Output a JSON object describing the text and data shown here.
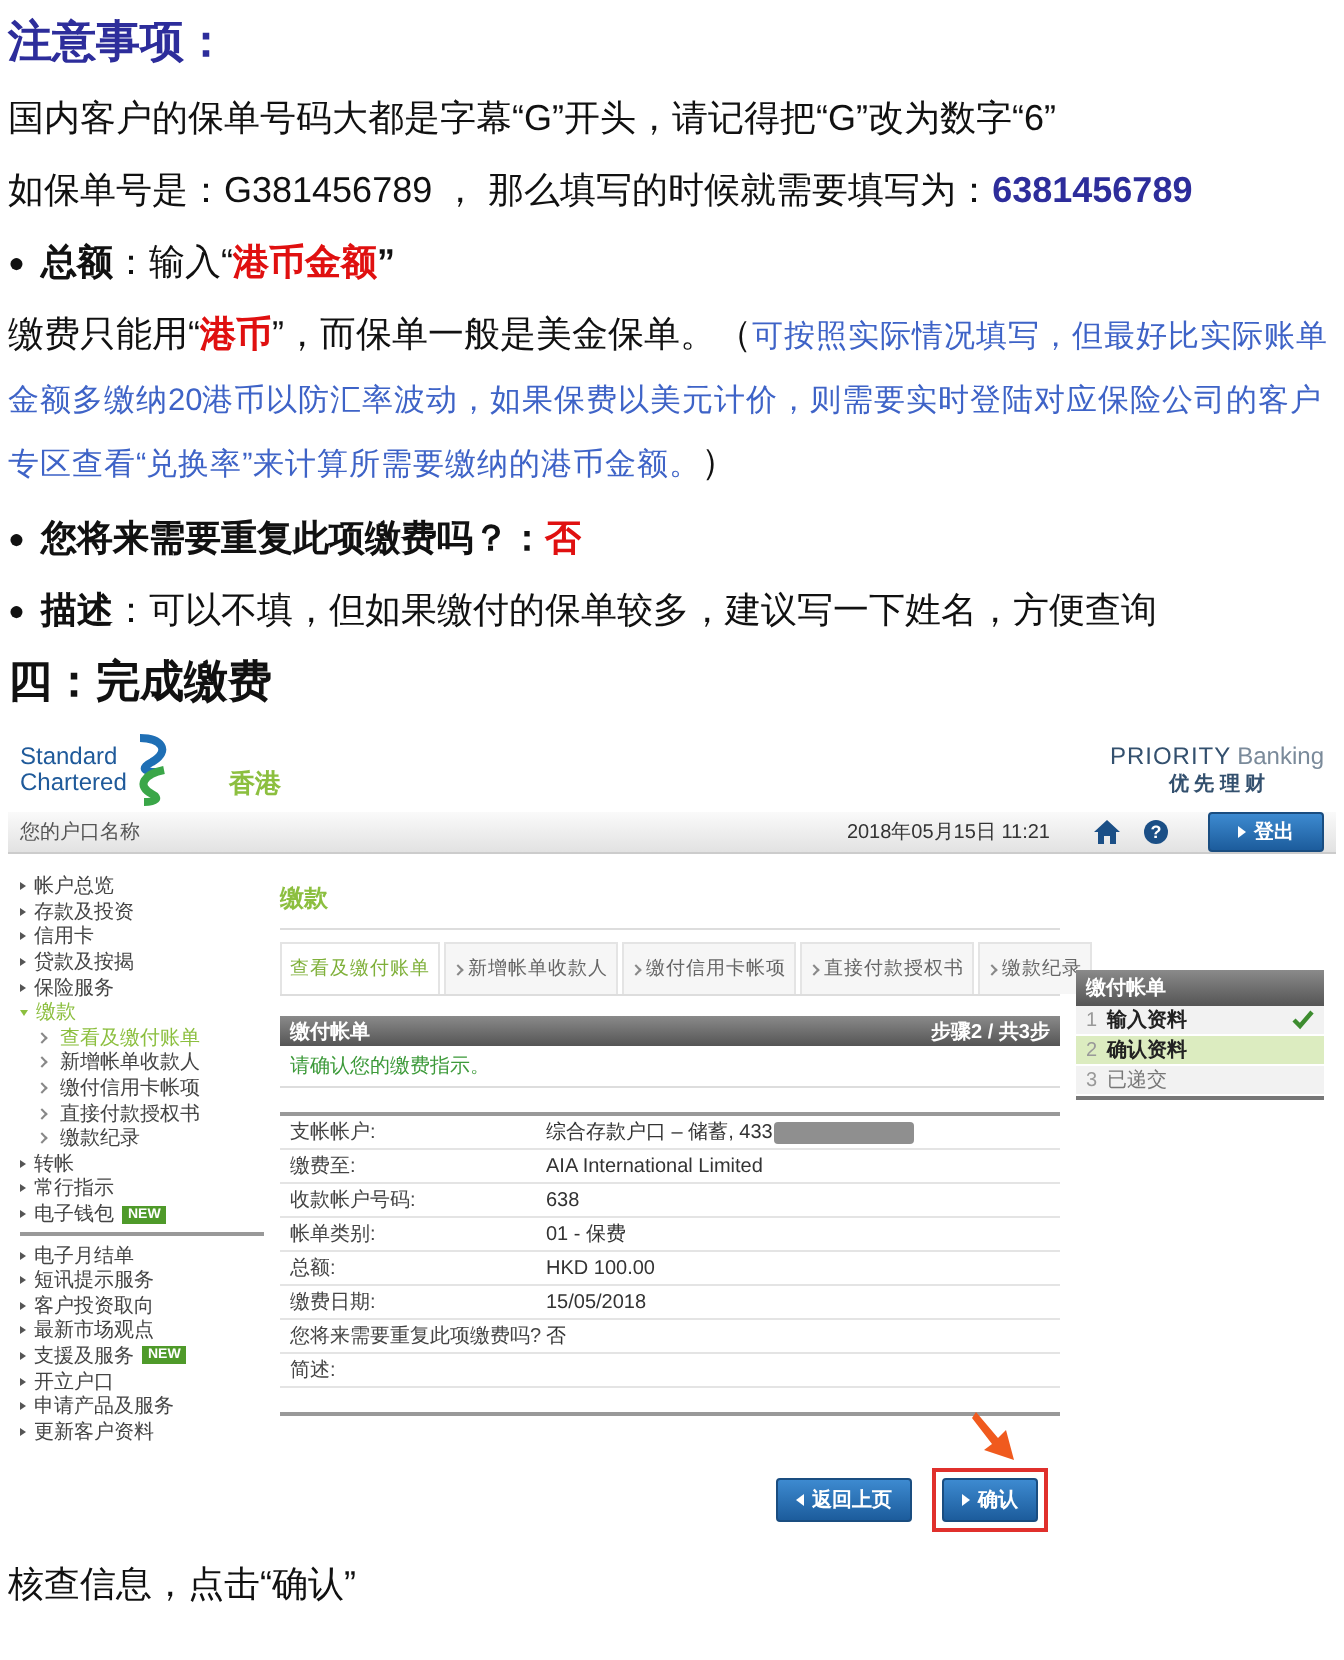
{
  "blocks": [
    {
      "kind": "heading",
      "segments": [
        {
          "kind": "navy",
          "text": "注意事项："
        }
      ]
    },
    {
      "kind": "para",
      "segments": [
        {
          "kind": "plain",
          "text": "国内客户的保单号码大都是字幕“G”开头，请记得把“G”改为数字“6”"
        }
      ]
    },
    {
      "kind": "para",
      "segments": [
        {
          "kind": "plain",
          "text": "如保单号是：G381456789 ， 那么填写的时候就需要填写为："
        },
        {
          "kind": "navy",
          "text": "6381456789"
        }
      ]
    },
    {
      "kind": "bullet",
      "bullet": "●",
      "segments": [
        {
          "kind": "bold",
          "text": "总额"
        },
        {
          "kind": "plain",
          "text": "：输入“"
        },
        {
          "kind": "red",
          "text": "港币金额"
        },
        {
          "kind": "bold",
          "text": "”"
        }
      ]
    },
    {
      "kind": "para",
      "segments": [
        {
          "kind": "plain",
          "text": "缴费只能用“"
        },
        {
          "kind": "red",
          "text": "港币"
        },
        {
          "kind": "plain",
          "text": "”，而保单一般是美金保单。（"
        },
        {
          "kind": "note",
          "text": "可按照实际情况填写，但最好比实际账单金额多缴纳20港币以防汇率波动，如果保费以美元计价，则需要实时登陆对应保险公司的客户专区查看“兑换率”来计算所需要缴纳的港币金额。"
        },
        {
          "kind": "plain",
          "text": "）"
        }
      ]
    },
    {
      "kind": "bullet",
      "bullet": "●",
      "segments": [
        {
          "kind": "bold",
          "text": "您将来需要重复此项缴费吗？："
        },
        {
          "kind": "red",
          "text": "否"
        }
      ]
    },
    {
      "kind": "bullet",
      "bullet": "●",
      "segments": [
        {
          "kind": "bold",
          "text": "描述"
        },
        {
          "kind": "plain",
          "text": "：可以不填，但如果缴付的保单较多，建议写一下姓名，方便查询"
        }
      ]
    },
    {
      "kind": "heading",
      "segments": [
        {
          "kind": "bold",
          "text": "四：完成缴费"
        }
      ]
    }
  ],
  "bank": {
    "brand": [
      "Standard",
      "Chartered"
    ],
    "region": "香港",
    "tier": {
      "name": "PRIORITY",
      "suffix": "Banking",
      "chinese": "优 先 理 财"
    },
    "account_name": "您的户口名称",
    "datetime": "2018年05月15日 11:21",
    "help": "?",
    "logout": "登出",
    "nav_groups": [
      [
        {
          "label": "帐户总览",
          "expanded": false
        },
        {
          "label": "存款及投资",
          "expanded": false
        },
        {
          "label": "信用卡",
          "expanded": false
        },
        {
          "label": "贷款及按揭",
          "expanded": false
        },
        {
          "label": "保险服务",
          "expanded": false
        },
        {
          "label": "缴款",
          "expanded": true,
          "children": [
            {
              "label": "查看及缴付账单",
              "selected": true
            },
            {
              "label": "新增帐单收款人",
              "selected": false
            },
            {
              "label": "缴付信用卡帐项",
              "selected": false
            },
            {
              "label": "直接付款授权书",
              "selected": false
            },
            {
              "label": "缴款纪录",
              "selected": false
            }
          ]
        },
        {
          "label": "转帐",
          "expanded": false
        },
        {
          "label": "常行指示",
          "expanded": false
        },
        {
          "label": "电子钱包",
          "expanded": false,
          "badge": "NEW"
        }
      ],
      [
        {
          "label": "电子月结单",
          "expanded": false
        },
        {
          "label": "短讯提示服务",
          "expanded": false
        },
        {
          "label": "客户投资取向",
          "expanded": false
        },
        {
          "label": "最新市场观点",
          "expanded": false
        },
        {
          "label": "支援及服务",
          "expanded": false,
          "badge": "NEW"
        },
        {
          "label": "开立户口",
          "expanded": false
        },
        {
          "label": "申请产品及服务",
          "expanded": false
        },
        {
          "label": "更新客户资料",
          "expanded": false
        }
      ]
    ],
    "page_title": "缴款",
    "tabs": [
      {
        "label": "查看及缴付账单",
        "selected": true
      },
      {
        "label": "新增帐单收款人",
        "selected": false
      },
      {
        "label": "缴付信用卡帐项",
        "selected": false
      },
      {
        "label": "直接付款授权书",
        "selected": false
      },
      {
        "label": "缴款纪录",
        "selected": false
      }
    ],
    "panel": {
      "title": "缴付帐单",
      "step": "步骤2 / 共3步",
      "notice": "请确认您的缴费指示。",
      "rows": [
        {
          "label": "支帐帐户:",
          "value": "综合存款户口 – 储蓄, 433",
          "redacted": true
        },
        {
          "label": "缴费至:",
          "value": "AIA International Limited",
          "redacted": false
        },
        {
          "label": "收款帐户号码:",
          "value": "638",
          "redacted": false
        },
        {
          "label": "帐单类别:",
          "value": "01 - 保费",
          "redacted": false
        },
        {
          "label": "总额:",
          "value": "HKD  100.00",
          "redacted": false
        },
        {
          "label": "缴费日期:",
          "value": "15/05/2018",
          "redacted": false
        },
        {
          "label": "您将来需要重复此项缴费吗?",
          "value": "否",
          "redacted": false
        },
        {
          "label": "简述:",
          "redacted": false
        }
      ]
    },
    "steps": {
      "title": "缴付帐单",
      "items": [
        {
          "number": "1",
          "label": "输入资料",
          "checked": true,
          "selected": false
        },
        {
          "number": "2",
          "label": "确认资料",
          "checked": false,
          "selected": true
        },
        {
          "number": "3",
          "label": "已递交",
          "checked": false,
          "selected": false
        }
      ]
    },
    "buttons": [
      {
        "label": "返回上页",
        "kind": "back",
        "highlighted": false
      },
      {
        "label": "确认",
        "kind": "forward",
        "highlighted": true
      }
    ]
  },
  "caption": "核查信息，点击“确认”"
}
